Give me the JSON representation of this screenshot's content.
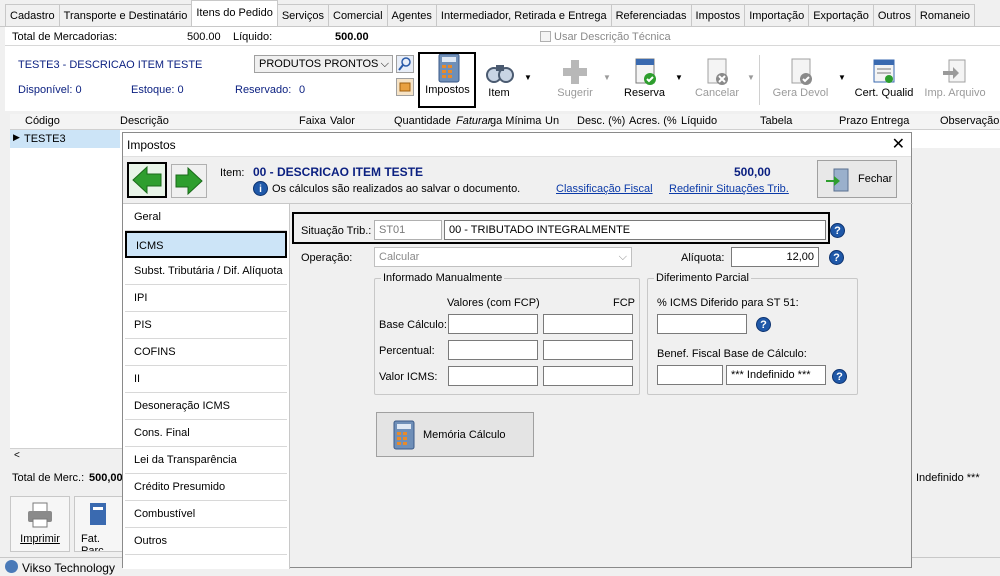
{
  "tabs": [
    "Cadastro",
    "Transporte e Destinatário",
    "Itens do Pedido",
    "Serviços",
    "Comercial",
    "Agentes",
    "Intermediador, Retirada e Entrega",
    "Referenciadas",
    "Impostos",
    "Importação",
    "Exportação",
    "Outros",
    "Romaneio"
  ],
  "active_tab": "Itens do Pedido",
  "header": {
    "total_mercadorias_label": "Total de Mercadorias:",
    "total_mercadorias_value": "500.00",
    "liquido_label": "Líquido:",
    "liquido_value": "500.00",
    "usar_desc_label": "Usar Descrição Técnica",
    "item_name": "TESTE3 - DESCRICAO ITEM TESTE",
    "produtos_select": "PRODUTOS PRONTOS",
    "disponivel": "Disponível: 0",
    "estoque": "Estoque: 0",
    "reservado_label": "Reservado:",
    "reservado_value": "0"
  },
  "toolbar": {
    "impostos": "Impostos",
    "item": "Item",
    "sugerir": "Sugerir",
    "reserva": "Reserva",
    "cancelar": "Cancelar",
    "gera_devol": "Gera Devol",
    "cert_qualid": "Cert. Qualid",
    "imp_arquivo": "Imp. Arquivo"
  },
  "grid": {
    "columns": [
      "Código",
      "Descrição",
      "Faixa",
      "Valor",
      "Quantidade",
      "Faturar",
      "ga Mínima",
      "Un",
      "Desc. (%)",
      "Acres. (%",
      "Líquido",
      "Tabela",
      "Prazo Entrega",
      "Observação"
    ],
    "row_code": "TESTE3"
  },
  "footer": {
    "total_merc_label": "Total de Merc.:",
    "total_merc_value": "500,00",
    "indefinido": "Indefinido ***",
    "imprimir": "Imprimir",
    "fat_parc": "Fat. Parc",
    "status_bar": "Vikso Technology"
  },
  "modal": {
    "title": "Impostos",
    "item_label": "Item:",
    "item_value": "00 - DESCRICAO ITEM TESTE",
    "item_total": "500,00",
    "info_text": "Os cálculos são realizados ao salvar o documento.",
    "link_classificacao": "Classificação Fiscal",
    "link_redefinir": "Redefinir Situações Trib.",
    "fechar": "Fechar",
    "sidebar": [
      "Geral",
      "ICMS",
      "Subst. Tributária / Dif. Alíquota",
      "IPI",
      "PIS",
      "COFINS",
      "II",
      "Desoneração ICMS",
      "Cons. Final",
      "Lei da Transparência",
      "Crédito Presumido",
      "Combustível",
      "Outros"
    ],
    "active_side": "ICMS",
    "situacao_label": "Situação Trib.:",
    "situacao_code": "ST01",
    "situacao_desc": "00 - TRIBUTADO INTEGRALMENTE",
    "operacao_label": "Operação:",
    "operacao_value": "Calcular",
    "aliquota_label": "Alíquota:",
    "aliquota_value": "12,00",
    "informado_title": "Informado Manualmente",
    "valores_fcp_label": "Valores (com FCP)",
    "fcp_label": "FCP",
    "base_calculo_label": "Base Cálculo:",
    "percentual_label": "Percentual:",
    "valor_icms_label": "Valor ICMS:",
    "diferimento_title": "Diferimento Parcial",
    "icms_diferido_label": "% ICMS Diferido para ST 51:",
    "benef_label": "Benef. Fiscal Base de Cálculo:",
    "indefinido": "*** Indefinido ***",
    "memoria_calculo": "Memória Cálculo"
  },
  "colors": {
    "link": "#0b3aa8",
    "title_blue": "#0a1f80",
    "selected_row": "#cce4f7",
    "green_arrow": "#2e9e2e"
  }
}
